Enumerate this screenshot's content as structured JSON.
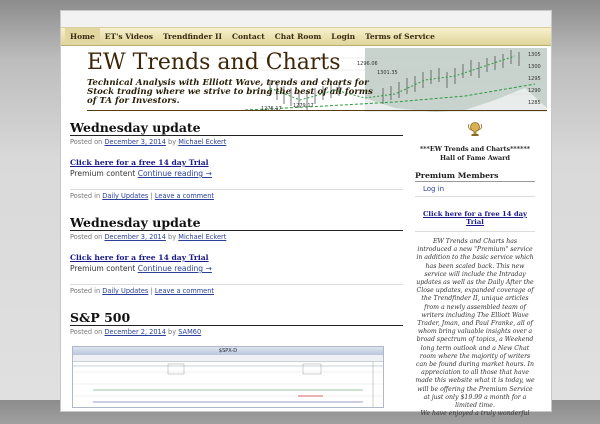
{
  "nav": {
    "items": [
      "Home",
      "ET's Videos",
      "Trendfinder II",
      "Contact",
      "Chat Room",
      "Login",
      "Terms of Service"
    ]
  },
  "header": {
    "title": "EW Trends and Charts",
    "description": "Technical Analysis with Elliott Wave, trends and charts for Stock trading where we strive to bring the best of all forms of TA for Investors.",
    "chart_labels": [
      "1305",
      "1300",
      "1295",
      "1290",
      "1285",
      "1296.06",
      "1301.35",
      "1276.17",
      "1279.17"
    ]
  },
  "posts": [
    {
      "title": "Wednesday update",
      "posted_on": "Posted on",
      "date": "December 3, 2014",
      "by": "by",
      "author": "Michael Eckert",
      "trial_link": "Click here for a free 14 day Trial",
      "excerpt": "Premium content",
      "read_more": "Continue reading →",
      "posted_in": "Posted in",
      "category": "Daily Updates",
      "separator": "|",
      "comment": "Leave a comment"
    },
    {
      "title": "Wednesday update",
      "posted_on": "Posted on",
      "date": "December 3, 2014",
      "by": "by",
      "author": "Michael Eckert",
      "trial_link": "Click here for a free 14 day Trial",
      "excerpt": "Premium content",
      "read_more": "Continue reading →",
      "posted_in": "Posted in",
      "category": "Daily Updates",
      "separator": "|",
      "comment": "Leave a comment"
    },
    {
      "title": "S&P 500",
      "posted_on": "Posted on",
      "date": "December 2, 2014",
      "by": "by",
      "author": "SAM60",
      "image_title": "$SPX-D"
    }
  ],
  "sidebar": {
    "award_title": "***EW Trends and Charts******",
    "award_subtitle": "Hall of Fame Award",
    "premium_title": "Premium Members",
    "login_label": "Log in",
    "trial_link": "Click here for a free 14 day Trial",
    "promo": "EW Trends and Charts has introduced a new \"Premium\" service in addition to the basic service which has been scaled back. This new service will include the Intraday updates as well as the Daily After the Close updates, expanded coverage of the Trendfinder II, unique articles from a newly assembled team of writers including The Elliott Wave Trader, Jman, and Paul Franke, all of whom bring valuable insights over a broad spectrum of topics, a Weekend long term outlook and a New Chat room where the majority of writers can be found during market hours. In appreciation to all those that have made this website what it is today, we will be offering the Premium Service at just only $19.99 a month for a limited time.",
    "promo_tail": "We have enjoyed a truly wonderful"
  },
  "colors": {
    "nav_bg": "#e9e0b0",
    "title_color": "#3d2608",
    "link_color": "#2a3f9a",
    "trial_link_color": "#1a1a8a",
    "award_gold": "#c8a040"
  },
  "icons": [
    "trophy-icon"
  ]
}
